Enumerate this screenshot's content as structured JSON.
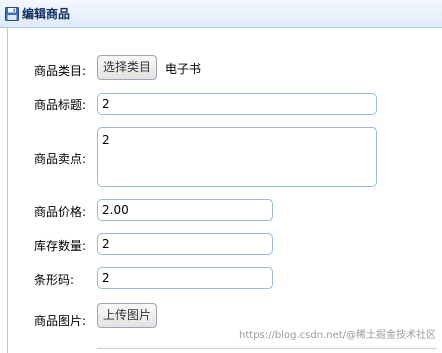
{
  "header": {
    "title": "编辑商品",
    "icon": "save-icon"
  },
  "form": {
    "category": {
      "label": "商品类目:",
      "button": "选择类目",
      "value": "电子书"
    },
    "title": {
      "label": "商品标题:",
      "value": "2"
    },
    "sell_point": {
      "label": "商品卖点:",
      "value": "2"
    },
    "price": {
      "label": "商品价格:",
      "value": "2.00"
    },
    "stock": {
      "label": "库存数量:",
      "value": "2"
    },
    "barcode": {
      "label": "条形码:",
      "value": "2"
    },
    "image": {
      "label": "商品图片:",
      "button": "上传图片"
    }
  },
  "watermark": "https://blog.csdn.net/@稀土掘金技术社区"
}
